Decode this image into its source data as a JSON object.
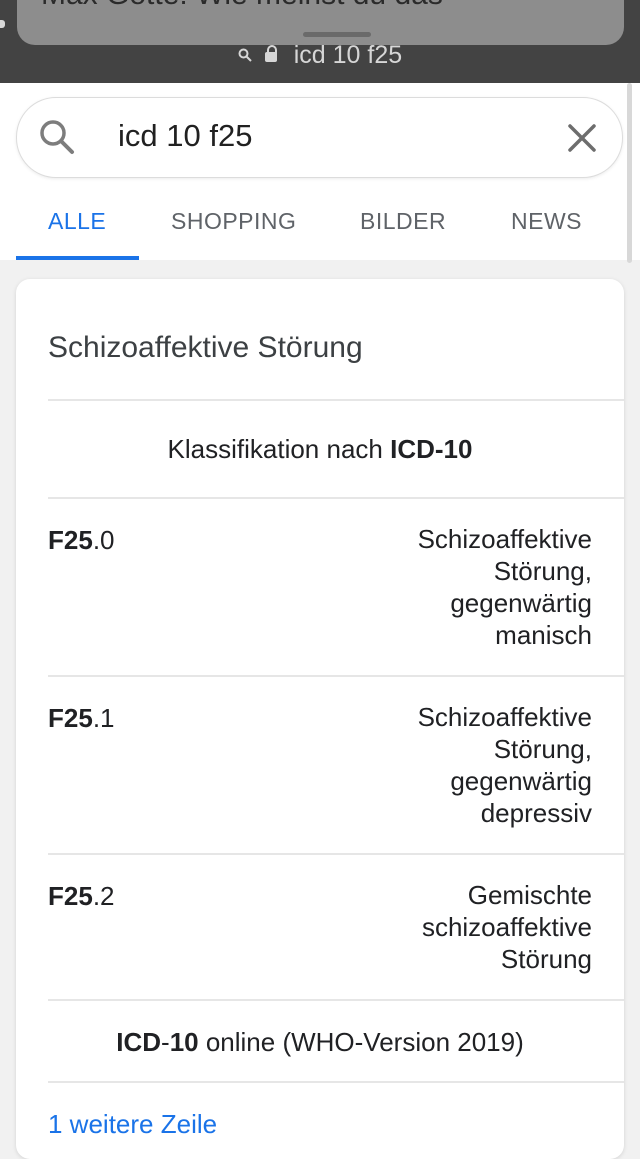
{
  "notification": {
    "text": "Max Gotte: Wie meinst du das"
  },
  "browser": {
    "url": "icd 10 f25"
  },
  "search": {
    "query": "icd 10 f25",
    "icons": {
      "search": "search-icon",
      "clear": "close-icon"
    }
  },
  "tabs": [
    {
      "label": "ALLE",
      "active": true
    },
    {
      "label": "SHOPPING",
      "active": false
    },
    {
      "label": "BILDER",
      "active": false
    },
    {
      "label": "NEWS",
      "active": false
    }
  ],
  "colors": {
    "accent": "#1a73e8",
    "text": "#202124",
    "topbar": "#434343"
  },
  "card": {
    "title": "Schizoaffektive Störung",
    "classification_prefix": "Klassifikation nach ",
    "classification_bold": "ICD-10",
    "rows": [
      {
        "code_bold": "F25",
        "code_suffix": ".0",
        "lines": [
          "Schizoaffektive",
          "Störung,",
          "gegenwärtig",
          "manisch"
        ]
      },
      {
        "code_bold": "F25",
        "code_suffix": ".1",
        "lines": [
          "Schizoaffektive",
          "Störung,",
          "gegenwärtig",
          "depressiv"
        ]
      },
      {
        "code_bold": "F25",
        "code_suffix": ".2",
        "lines": [
          "Gemischte",
          "schizoaffektive",
          "Störung"
        ]
      }
    ],
    "footer_bold": "ICD",
    "footer_dash": "-",
    "footer_bold2": "10",
    "footer_rest": " online (WHO-Version 2019)",
    "more_link": "1 weitere Zeile"
  }
}
